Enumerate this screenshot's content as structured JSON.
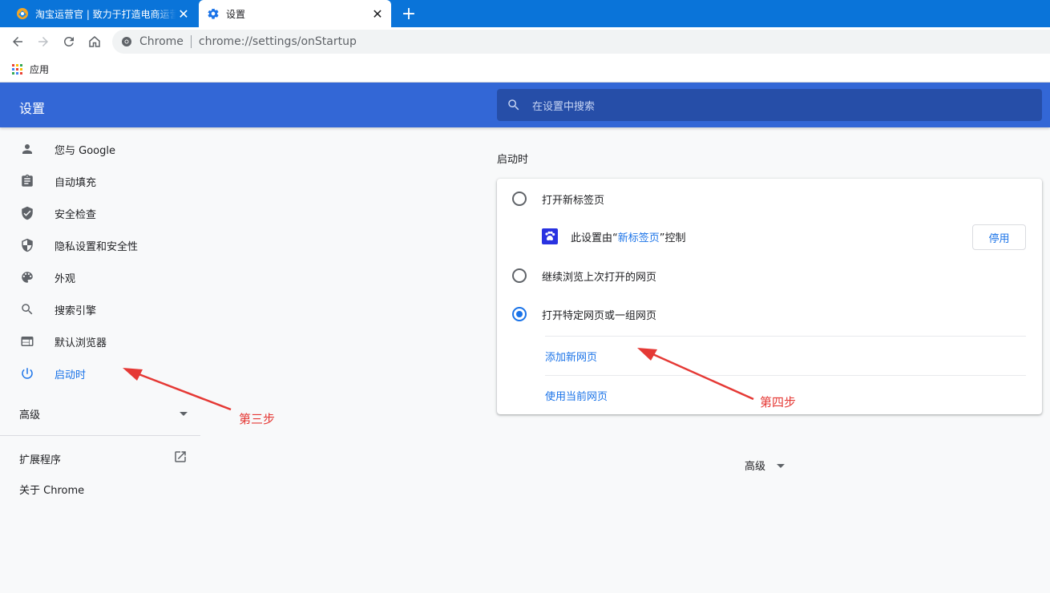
{
  "browser": {
    "tabs": [
      {
        "title": "淘宝运营官 | 致力于打造电商运营",
        "favicon": "taobao-logo-icon"
      },
      {
        "title": "设置",
        "favicon": "gear-icon"
      }
    ],
    "omnibox": {
      "origin": "Chrome",
      "url": "chrome://settings/onStartup"
    },
    "bookmarks": [
      {
        "label": "应用",
        "icon": "apps-grid-icon"
      }
    ]
  },
  "settings": {
    "title": "设置",
    "search_placeholder": "在设置中搜索"
  },
  "sidebar": {
    "items": [
      {
        "label": "您与 Google",
        "icon": "person-icon"
      },
      {
        "label": "自动填充",
        "icon": "clipboard-icon"
      },
      {
        "label": "安全检查",
        "icon": "shield-check-icon"
      },
      {
        "label": "隐私设置和安全性",
        "icon": "shield-half-icon"
      },
      {
        "label": "外观",
        "icon": "palette-icon"
      },
      {
        "label": "搜索引擎",
        "icon": "search-icon"
      },
      {
        "label": "默认浏览器",
        "icon": "browser-window-icon"
      },
      {
        "label": "启动时",
        "icon": "power-icon"
      }
    ],
    "active": "启动时",
    "advanced": "高级",
    "extensions": "扩展程序",
    "about": "关于 Chrome"
  },
  "startup": {
    "section_title": "启动时",
    "options": [
      {
        "label": "打开新标签页",
        "checked": false
      },
      {
        "label": "继续浏览上次打开的网页",
        "checked": false
      },
      {
        "label": "打开特定网页或一组网页",
        "checked": true
      }
    ],
    "controlled_note": {
      "prefix": "此设置由“",
      "extension": "新标签页",
      "suffix": "”控制"
    },
    "disable_button": "停用",
    "add_page": "添加新网页",
    "use_current": "使用当前网页",
    "advanced": "高级"
  },
  "annotations": {
    "step3": "第三步",
    "step4": "第四步"
  },
  "colors": {
    "tabstrip": "#0a74d9",
    "header": "#3367d6",
    "search_bg": "#264ea8",
    "accent": "#1a73e8",
    "annotation": "#e53935"
  }
}
